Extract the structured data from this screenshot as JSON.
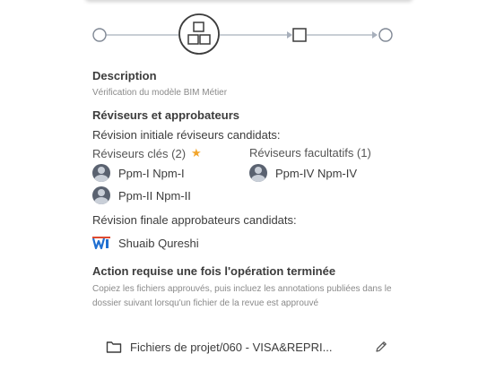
{
  "description": {
    "title": "Description",
    "text": "Vérification du modèle BIM Métier"
  },
  "reviewers": {
    "title": "Réviseurs et approbateurs",
    "initial_title": "Révision initiale réviseurs candidats:",
    "key_title": "Réviseurs clés (2)",
    "optional_title": "Réviseurs facultatifs (1)",
    "key_people": [
      "Ppm-I Npm-I",
      "Ppm-II Npm-II"
    ],
    "optional_people": [
      "Ppm-IV Npm-IV"
    ],
    "final_title": "Révision finale approbateurs candidats:",
    "approver": "Shuaib Qureshi"
  },
  "action": {
    "title": "Action requise une fois l'opération terminée",
    "text": "Copiez les fichiers approuvés, puis incluez les annotations publiées dans le dossier suivant lorsqu'un fichier de la revue est approuvé",
    "folder": "Fichiers de projet/060 - VISA&REPRI..."
  },
  "icons": {
    "workflow_step": "review-step-icon",
    "star": "star-icon",
    "folder": "folder-icon",
    "edit": "pencil-icon"
  },
  "colors": {
    "workflow_line": "#a8b0bc",
    "star": "#f2a52b",
    "avatar": "#5a6270"
  }
}
